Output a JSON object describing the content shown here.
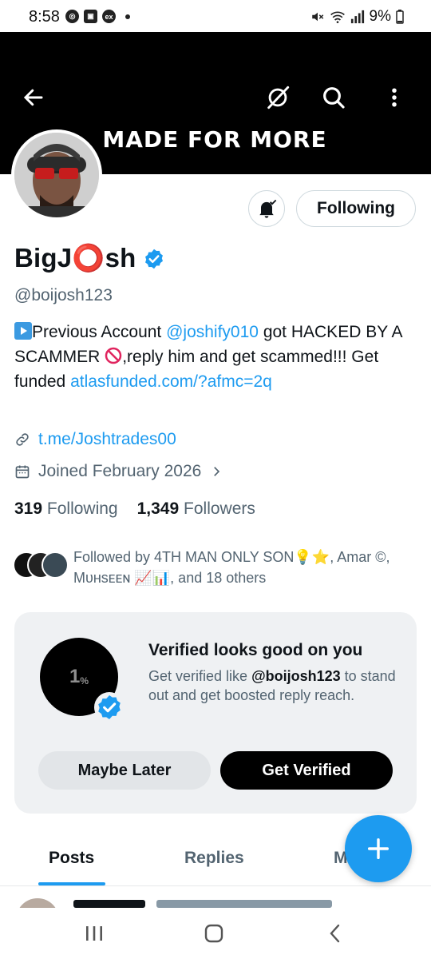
{
  "status_bar": {
    "time": "8:58",
    "battery": "9%",
    "left_icons": [
      "whatsapp-icon",
      "gallery-icon",
      "ex-icon"
    ],
    "ex_label": "ex"
  },
  "header": {
    "icons": [
      "back-arrow-icon",
      "grok-icon",
      "search-icon",
      "more-vertical-icon"
    ]
  },
  "banner": {
    "text": "MADE FOR MORE"
  },
  "profile": {
    "name": "BigJ⭕sh",
    "handle": "@boijosh123",
    "bio": {
      "part1": "Previous Account ",
      "mention": "@joshify010",
      "part2": " got HACKED BY A SCAMMER ",
      "part3": ",reply him and get scammed!!!   Get funded ",
      "link": "atlasfunded.com/?afmc=2q"
    },
    "website": "t.me/Joshtrades00",
    "joined": "Joined February 2026",
    "following_count": "319",
    "following_label": "Following",
    "followers_count": "1,349",
    "followers_label": "Followers",
    "follow_button": "Following",
    "followed_by": "Followed by 4TH MAN ONLY SON💡⭐, Amar ©, Mᴜʜsᴇᴇɴ 📈📊, and 18 others"
  },
  "verify_card": {
    "badge_text": "1",
    "badge_unit": "%",
    "title": "Verified looks good on you",
    "desc_prefix": "Get verified like ",
    "desc_handle": "@boijosh123",
    "desc_suffix": " to stand out and get boosted reply reach.",
    "maybe_later": "Maybe Later",
    "get_verified": "Get Verified"
  },
  "tabs": [
    {
      "label": "Posts",
      "active": true
    },
    {
      "label": "Replies",
      "active": false
    },
    {
      "label": "M",
      "active": false
    }
  ],
  "colors": {
    "accent": "#1d9bf0",
    "text": "#0f1419",
    "muted": "#536471"
  }
}
